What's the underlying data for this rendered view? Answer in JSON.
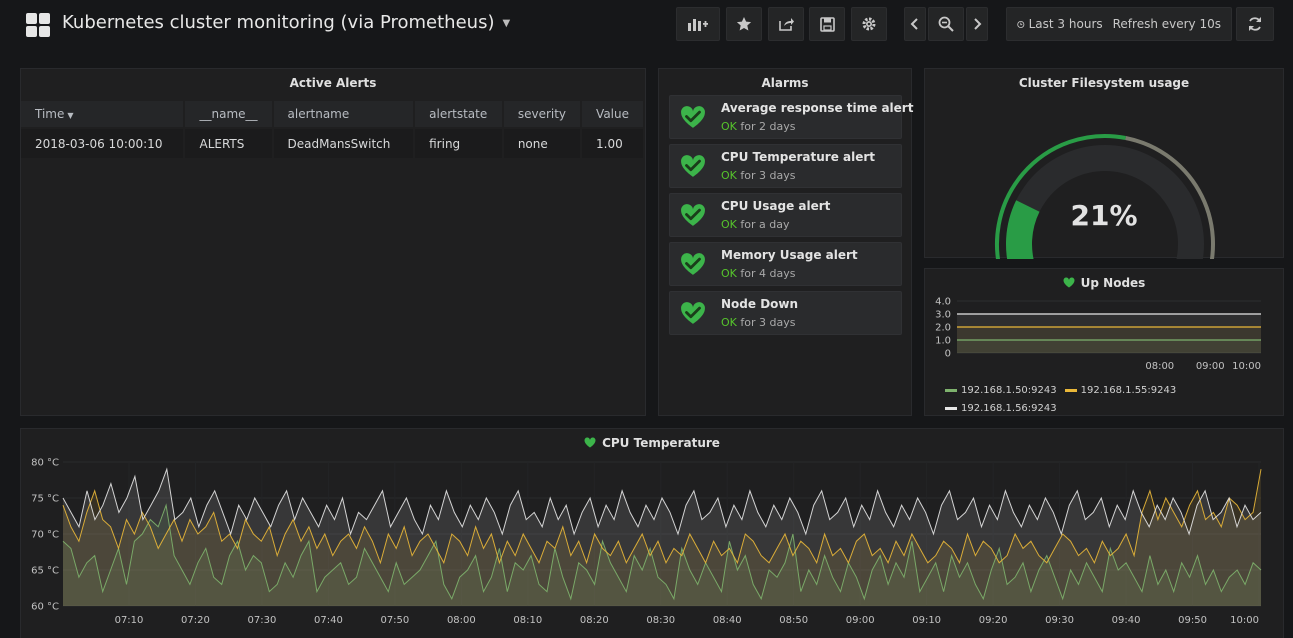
{
  "header": {
    "title": "Kubernetes cluster monitoring (via Prometheus)",
    "time_range": "Last 3 hours",
    "refresh": "Refresh every 10s"
  },
  "active_alerts": {
    "title": "Active Alerts",
    "columns": [
      "Time",
      "__name__",
      "alertname",
      "alertstate",
      "severity",
      "Value"
    ],
    "rows": [
      [
        "2018-03-06 10:00:10",
        "ALERTS",
        "DeadMansSwitch",
        "firing",
        "none",
        "1.00"
      ]
    ]
  },
  "alarms": {
    "title": "Alarms",
    "items": [
      {
        "name": "Average response time alert",
        "state": "OK",
        "duration": "for 2 days"
      },
      {
        "name": "CPU Temperature alert",
        "state": "OK",
        "duration": "for 3 days"
      },
      {
        "name": "CPU Usage alert",
        "state": "OK",
        "duration": "for a day"
      },
      {
        "name": "Memory Usage alert",
        "state": "OK",
        "duration": "for 4 days"
      },
      {
        "name": "Node Down",
        "state": "OK",
        "duration": "for 3 days"
      }
    ]
  },
  "filesystem": {
    "title": "Cluster Filesystem usage",
    "value": 21,
    "display": "21%",
    "colors": {
      "fill": "#299c46",
      "track": "#7a7a6e",
      "threshold_green": "#299c46"
    }
  },
  "up_nodes": {
    "title": "Up Nodes",
    "y_ticks": [
      "4.0",
      "3.0",
      "2.0",
      "1.0",
      "0"
    ],
    "x_ticks": [
      "08:00",
      "09:00",
      "10:00"
    ],
    "legend": [
      "192.168.1.50:9243",
      "192.168.1.55:9243",
      "192.168.1.56:9243"
    ]
  },
  "cpu_temp": {
    "title": "CPU Temperature",
    "y_ticks": [
      "80 °C",
      "75 °C",
      "70 °C",
      "65 °C",
      "60 °C"
    ],
    "x_ticks": [
      "07:10",
      "07:20",
      "07:30",
      "07:40",
      "07:50",
      "08:00",
      "08:10",
      "08:20",
      "08:30",
      "08:40",
      "08:50",
      "09:00",
      "09:10",
      "09:20",
      "09:30",
      "09:40",
      "09:50",
      "10:00"
    ]
  },
  "colors": {
    "accent_green": "#56c42c",
    "heart_green": "#3cb44a",
    "series": [
      "#7eb26d",
      "#eab839",
      "#e6e6e6"
    ]
  },
  "chart_data": [
    {
      "type": "line",
      "title": "Up Nodes",
      "ylim": [
        0,
        4
      ],
      "x": [
        "07:00",
        "10:00"
      ],
      "series": [
        {
          "name": "192.168.1.50:9243",
          "values": [
            1,
            1
          ]
        },
        {
          "name": "192.168.1.55:9243",
          "values": [
            2,
            2
          ]
        },
        {
          "name": "192.168.1.56:9243",
          "values": [
            3,
            3
          ]
        }
      ]
    },
    {
      "type": "line",
      "title": "CPU Temperature",
      "ylim": [
        60,
        80
      ],
      "x_start": "07:00",
      "x_end": "10:00",
      "series": [
        {
          "name": "192.168.1.50:9243",
          "values": [
            69,
            68,
            64,
            66,
            67,
            62,
            65,
            68,
            63,
            69,
            70,
            72,
            71,
            74,
            67,
            65,
            63,
            66,
            68,
            64,
            63,
            67,
            69,
            65,
            67,
            66,
            62,
            63,
            66,
            64,
            67,
            69,
            62,
            64,
            65,
            66,
            63,
            64,
            68,
            66,
            64,
            62,
            66,
            63,
            64,
            65,
            67,
            69,
            63,
            61,
            64,
            65,
            67,
            62,
            64,
            68,
            62,
            66,
            65,
            67,
            63,
            62,
            68,
            64,
            61,
            66,
            65,
            63,
            69,
            66,
            64,
            62,
            67,
            65,
            68,
            64,
            63,
            61,
            68,
            65,
            63,
            66,
            64,
            62,
            69,
            65,
            67,
            63,
            61,
            65,
            64,
            66,
            70,
            62,
            65,
            63,
            67,
            64,
            62,
            66,
            64,
            61,
            65,
            67,
            63,
            66,
            64,
            69,
            62,
            64,
            66,
            62,
            67,
            64,
            66,
            63,
            61,
            65,
            68,
            63,
            64,
            66,
            62,
            65,
            67,
            64,
            61,
            65,
            63,
            66,
            64,
            62,
            68,
            65,
            66,
            64,
            62,
            67,
            63,
            65,
            62,
            66,
            64,
            67,
            63,
            65,
            62,
            64,
            65,
            63,
            66,
            65
          ]
        },
        {
          "name": "192.168.1.55:9243",
          "values": [
            74,
            71,
            69,
            73,
            76,
            72,
            71,
            68,
            72,
            70,
            73,
            71,
            68,
            70,
            72,
            69,
            72,
            70,
            71,
            73,
            69,
            70,
            68,
            72,
            70,
            69,
            71,
            67,
            70,
            72,
            69,
            71,
            68,
            70,
            67,
            69,
            70,
            68,
            71,
            69,
            66,
            70,
            68,
            71,
            67,
            69,
            70,
            68,
            66,
            70,
            69,
            67,
            71,
            68,
            70,
            66,
            69,
            67,
            70,
            68,
            66,
            69,
            68,
            71,
            67,
            69,
            66,
            70,
            68,
            67,
            69,
            66,
            68,
            70,
            67,
            69,
            66,
            68,
            67,
            70,
            68,
            66,
            69,
            67,
            68,
            66,
            70,
            69,
            67,
            66,
            68,
            70,
            67,
            69,
            68,
            66,
            70,
            67,
            68,
            66,
            69,
            70,
            67,
            68,
            66,
            69,
            67,
            70,
            68,
            66,
            67,
            69,
            68,
            66,
            70,
            67,
            69,
            68,
            66,
            67,
            70,
            68,
            69,
            67,
            66,
            68,
            70,
            69,
            67,
            68,
            66,
            69,
            67,
            68,
            70,
            67,
            73,
            76,
            72,
            75,
            73,
            71,
            74,
            76,
            72,
            73,
            71,
            75,
            74,
            72,
            73,
            79
          ]
        },
        {
          "name": "192.168.1.56:9243",
          "values": [
            75,
            73,
            71,
            76,
            72,
            74,
            77,
            73,
            75,
            78,
            72,
            74,
            76,
            79,
            72,
            73,
            75,
            71,
            74,
            76,
            73,
            70,
            74,
            72,
            75,
            73,
            71,
            74,
            76,
            72,
            75,
            73,
            71,
            74,
            72,
            75,
            70,
            73,
            72,
            74,
            76,
            71,
            73,
            75,
            72,
            70,
            74,
            72,
            76,
            73,
            71,
            74,
            72,
            75,
            73,
            70,
            74,
            76,
            72,
            73,
            71,
            75,
            72,
            74,
            70,
            73,
            75,
            71,
            74,
            72,
            76,
            73,
            71,
            74,
            72,
            75,
            73,
            70,
            74,
            76,
            72,
            73,
            75,
            71,
            74,
            72,
            76,
            73,
            71,
            74,
            72,
            75,
            73,
            70,
            74,
            76,
            72,
            73,
            75,
            71,
            74,
            72,
            76,
            73,
            71,
            74,
            72,
            75,
            73,
            70,
            74,
            76,
            72,
            73,
            75,
            71,
            74,
            72,
            76,
            73,
            71,
            74,
            72,
            75,
            73,
            70,
            74,
            76,
            72,
            73,
            75,
            71,
            74,
            72,
            76,
            73,
            71,
            74,
            72,
            75,
            73,
            70,
            74,
            76,
            72,
            73,
            75,
            71,
            74,
            72,
            73
          ]
        }
      ]
    }
  ]
}
